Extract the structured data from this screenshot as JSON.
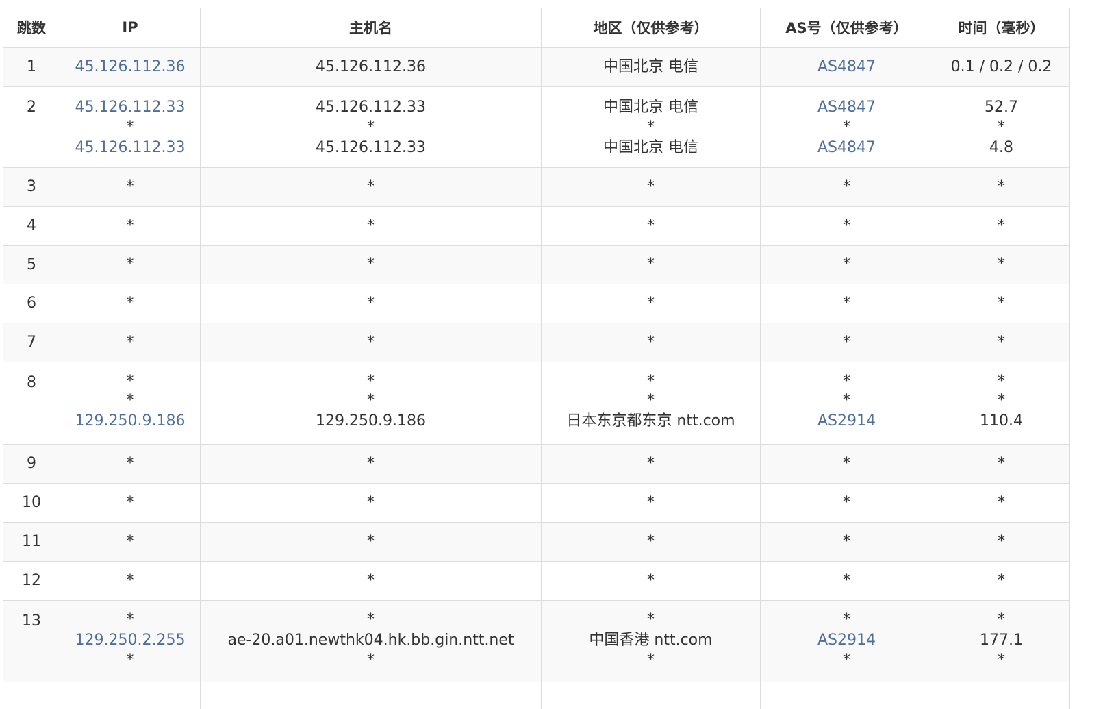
{
  "table": {
    "headers": {
      "hop": "跳数",
      "ip": "IP",
      "host": "主机名",
      "region": "地区（仅供参考）",
      "asn": "AS号（仅供参考）",
      "time": "时间（毫秒）"
    },
    "rows": [
      {
        "hop": "1",
        "ip": [
          "45.126.112.36"
        ],
        "host": [
          "45.126.112.36"
        ],
        "region": [
          "中国北京 电信"
        ],
        "asn": [
          "AS4847"
        ],
        "time": [
          "0.1 / 0.2 / 0.2"
        ]
      },
      {
        "hop": "2",
        "ip": [
          "45.126.112.33",
          "*",
          "45.126.112.33"
        ],
        "host": [
          "45.126.112.33",
          "*",
          "45.126.112.33"
        ],
        "region": [
          "中国北京 电信",
          "*",
          "中国北京 电信"
        ],
        "asn": [
          "AS4847",
          "*",
          "AS4847"
        ],
        "time": [
          "52.7",
          "*",
          "4.8"
        ]
      },
      {
        "hop": "3",
        "ip": [
          "*"
        ],
        "host": [
          "*"
        ],
        "region": [
          "*"
        ],
        "asn": [
          "*"
        ],
        "time": [
          "*"
        ]
      },
      {
        "hop": "4",
        "ip": [
          "*"
        ],
        "host": [
          "*"
        ],
        "region": [
          "*"
        ],
        "asn": [
          "*"
        ],
        "time": [
          "*"
        ]
      },
      {
        "hop": "5",
        "ip": [
          "*"
        ],
        "host": [
          "*"
        ],
        "region": [
          "*"
        ],
        "asn": [
          "*"
        ],
        "time": [
          "*"
        ]
      },
      {
        "hop": "6",
        "ip": [
          "*"
        ],
        "host": [
          "*"
        ],
        "region": [
          "*"
        ],
        "asn": [
          "*"
        ],
        "time": [
          "*"
        ]
      },
      {
        "hop": "7",
        "ip": [
          "*"
        ],
        "host": [
          "*"
        ],
        "region": [
          "*"
        ],
        "asn": [
          "*"
        ],
        "time": [
          "*"
        ]
      },
      {
        "hop": "8",
        "ip": [
          "*",
          "*",
          "129.250.9.186"
        ],
        "host": [
          "*",
          "*",
          "129.250.9.186"
        ],
        "region": [
          "*",
          "*",
          "日本东京都东京 ntt.com"
        ],
        "asn": [
          "*",
          "*",
          "AS2914"
        ],
        "time": [
          "*",
          "*",
          "110.4"
        ]
      },
      {
        "hop": "9",
        "ip": [
          "*"
        ],
        "host": [
          "*"
        ],
        "region": [
          "*"
        ],
        "asn": [
          "*"
        ],
        "time": [
          "*"
        ]
      },
      {
        "hop": "10",
        "ip": [
          "*"
        ],
        "host": [
          "*"
        ],
        "region": [
          "*"
        ],
        "asn": [
          "*"
        ],
        "time": [
          "*"
        ]
      },
      {
        "hop": "11",
        "ip": [
          "*"
        ],
        "host": [
          "*"
        ],
        "region": [
          "*"
        ],
        "asn": [
          "*"
        ],
        "time": [
          "*"
        ]
      },
      {
        "hop": "12",
        "ip": [
          "*"
        ],
        "host": [
          "*"
        ],
        "region": [
          "*"
        ],
        "asn": [
          "*"
        ],
        "time": [
          "*"
        ]
      },
      {
        "hop": "13",
        "ip": [
          "*",
          "129.250.2.255",
          "*"
        ],
        "host": [
          "*",
          "ae-20.a01.newthk04.hk.bb.gin.ntt.net",
          "*"
        ],
        "region": [
          "*",
          "中国香港 ntt.com",
          "*"
        ],
        "asn": [
          "*",
          "AS2914",
          "*"
        ],
        "time": [
          "*",
          "177.1",
          "*"
        ]
      },
      {
        "hop": "",
        "ip": [
          ""
        ],
        "host": [
          ""
        ],
        "region": [
          ""
        ],
        "asn": [
          ""
        ],
        "time": [
          ""
        ]
      }
    ]
  },
  "colors": {
    "link": "#4f6f9a",
    "border": "#dddddd",
    "stripe": "#f9f9f9",
    "text": "#333333"
  }
}
